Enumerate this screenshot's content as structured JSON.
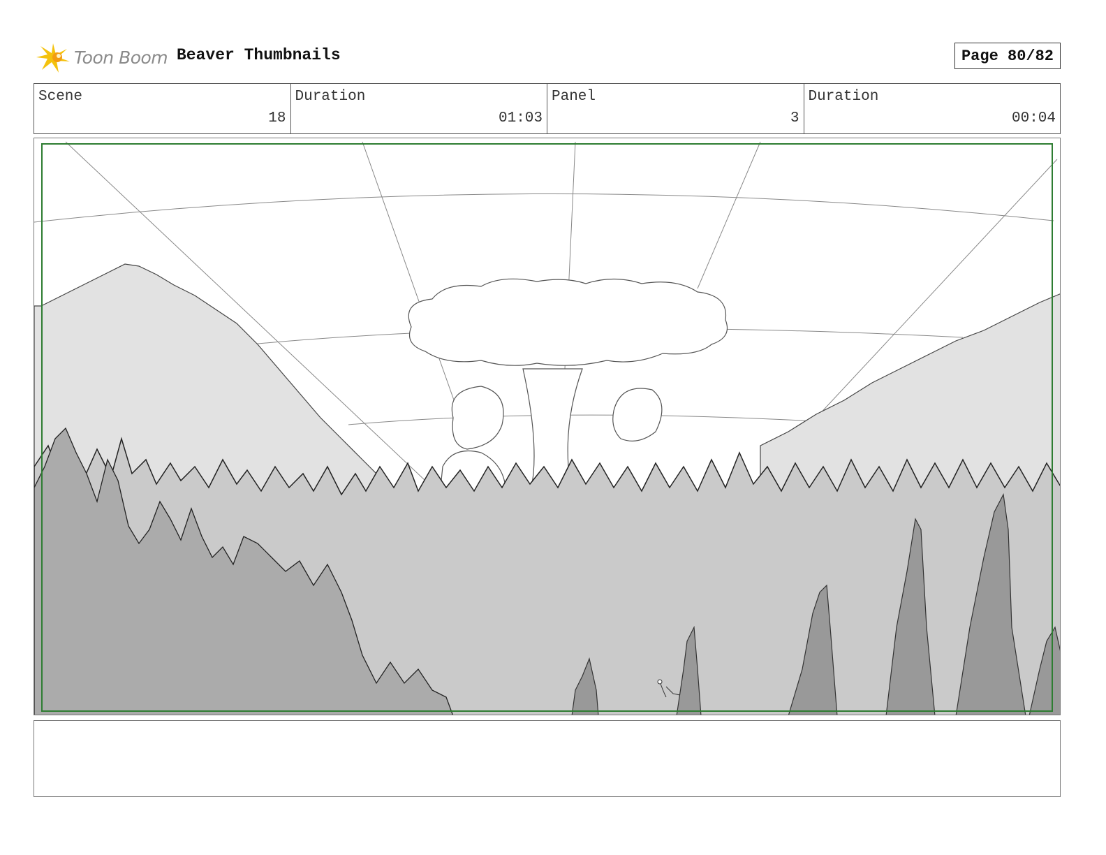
{
  "header": {
    "logo_text": "Toon Boom",
    "project_title": "Beaver Thumbnails",
    "page_label": "Page 80/82"
  },
  "info": {
    "scene_label": "Scene",
    "scene_value": "18",
    "scene_duration_label": "Duration",
    "scene_duration_value": "01:03",
    "panel_label": "Panel",
    "panel_value": "3",
    "panel_duration_label": "Duration",
    "panel_duration_value": "00:04"
  },
  "panel": {
    "frame_color": "#2e7d32",
    "sky_color": "#ffffff",
    "mountain_color": "#e2e2e2",
    "midground_color": "#cacaca",
    "foreground_color": "#ababab",
    "tree_color": "#999999",
    "line_color": "#444444"
  },
  "notes": {
    "text": ""
  },
  "colors": {
    "logo_yellow": "#f4c20d",
    "logo_orange": "#f39c12",
    "logo_text": "#8a8a8a"
  }
}
